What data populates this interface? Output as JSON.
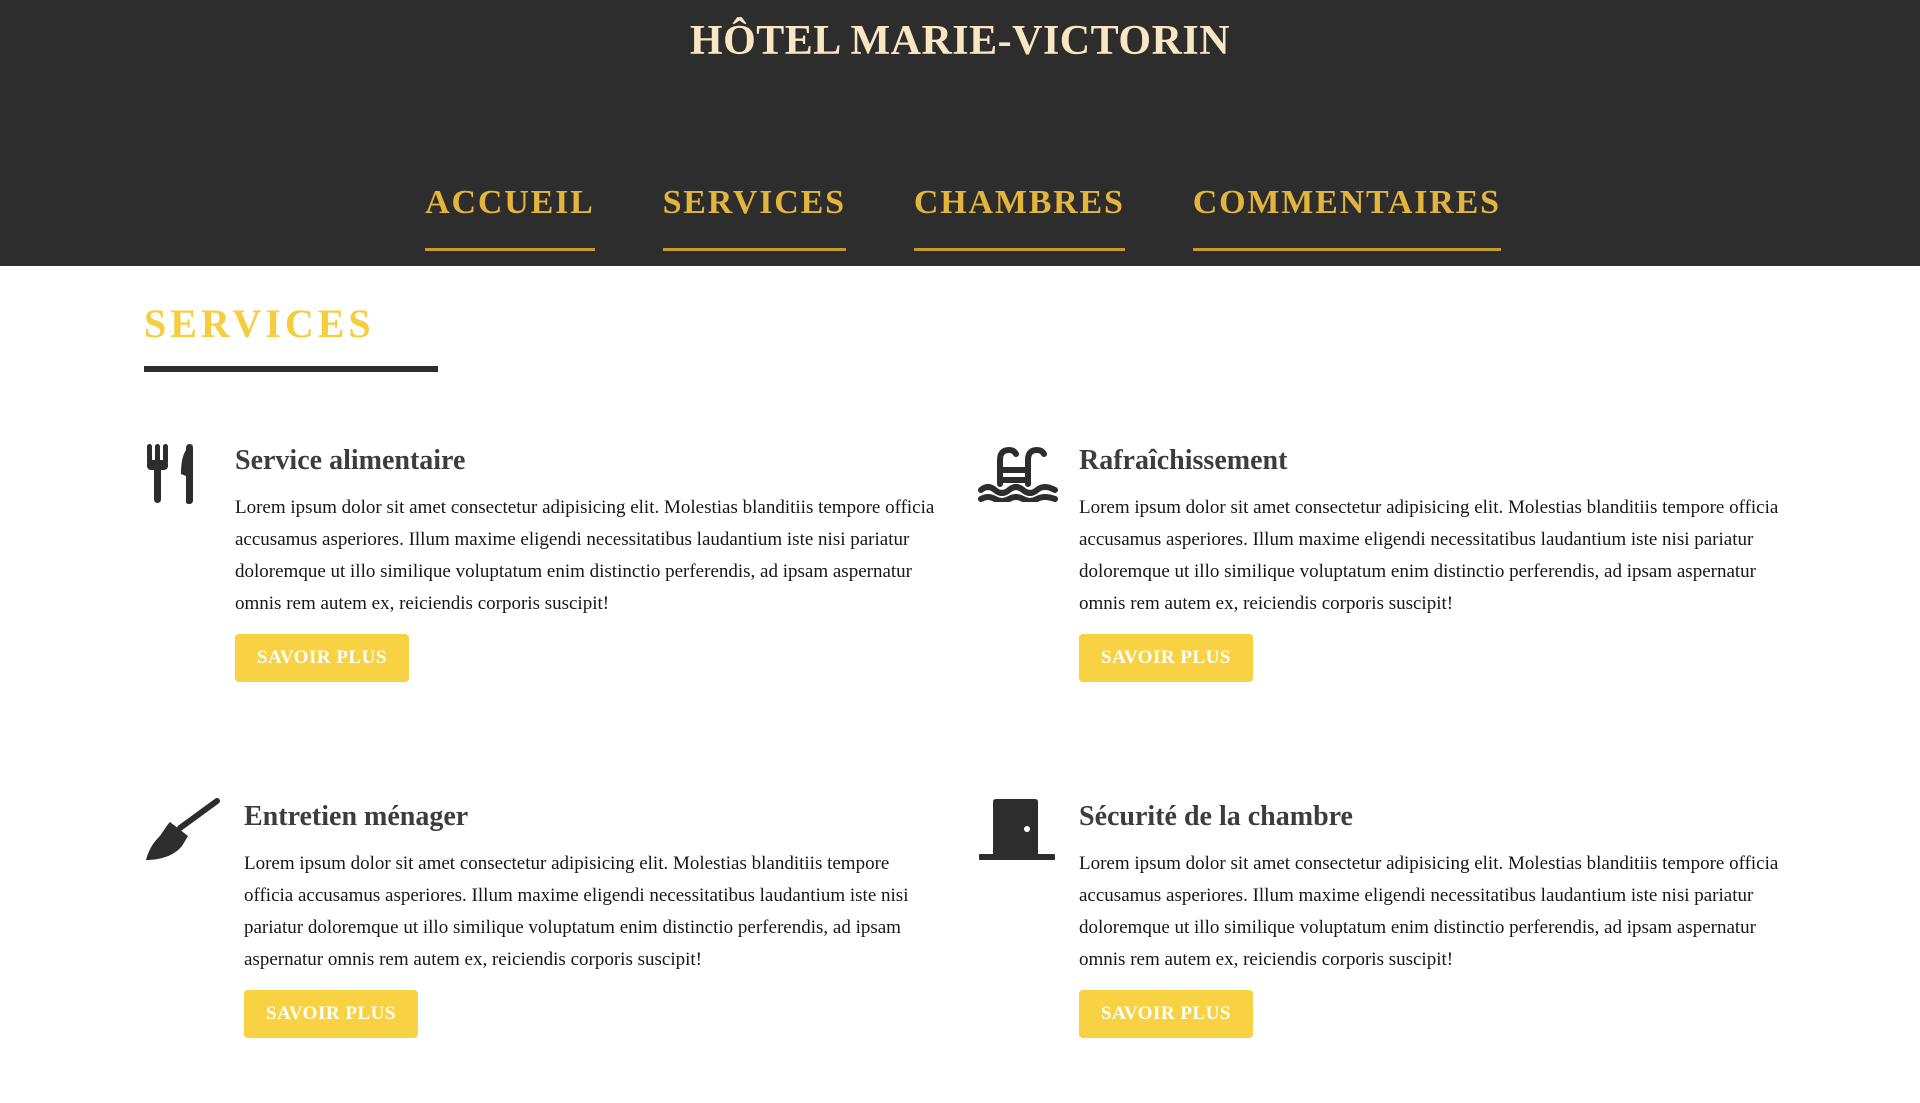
{
  "header": {
    "brand": "HÔTEL MARIE-VICTORIN",
    "nav": [
      {
        "label": "ACCUEIL"
      },
      {
        "label": "SERVICES"
      },
      {
        "label": "CHAMBRES"
      },
      {
        "label": "COMMENTAIRES"
      }
    ]
  },
  "main": {
    "section_title": "SERVICES",
    "services": [
      {
        "icon": "utensils-icon",
        "title": "Service alimentaire",
        "text": "Lorem ipsum dolor sit amet consectetur adipisicing elit. Molestias blanditiis tempore officia accusamus asperiores. Illum maxime eligendi necessitatibus laudantium iste nisi pariatur doloremque ut illo similique voluptatum enim distinctio perferendis, ad ipsam aspernatur omnis rem autem ex, reiciendis corporis suscipit!",
        "button": "SAVOIR PLUS"
      },
      {
        "icon": "swimming-pool-icon",
        "title": "Rafraîchissement",
        "text": "Lorem ipsum dolor sit amet consectetur adipisicing elit. Molestias blanditiis tempore officia accusamus asperiores. Illum maxime eligendi necessitatibus laudantium iste nisi pariatur doloremque ut illo similique voluptatum enim distinctio perferendis, ad ipsam aspernatur omnis rem autem ex, reiciendis corporis suscipit!",
        "button": "SAVOIR PLUS"
      },
      {
        "icon": "broom-icon",
        "title": "Entretien ménager",
        "text": "Lorem ipsum dolor sit amet consectetur adipisicing elit. Molestias blanditiis tempore officia accusamus asperiores. Illum maxime eligendi necessitatibus laudantium iste nisi pariatur doloremque ut illo similique voluptatum enim distinctio perferendis, ad ipsam aspernatur omnis rem autem ex, reiciendis corporis suscipit!",
        "button": "SAVOIR PLUS"
      },
      {
        "icon": "door-closed-icon",
        "title": "Sécurité de la chambre",
        "text": "Lorem ipsum dolor sit amet consectetur adipisicing elit. Molestias blanditiis tempore officia accusamus asperiores. Illum maxime eligendi necessitatibus laudantium iste nisi pariatur doloremque ut illo similique voluptatum enim distinctio perferendis, ad ipsam aspernatur omnis rem autem ex, reiciendis corporis suscipit!",
        "button": "SAVOIR PLUS"
      }
    ]
  },
  "colors": {
    "header_bg": "#2d2d2d",
    "brand_text": "#fbe6c3",
    "nav_text": "#e3b53c",
    "section_title": "#f5cd3d",
    "button_bg": "#f8d242",
    "icon": "#2d2d2d"
  }
}
